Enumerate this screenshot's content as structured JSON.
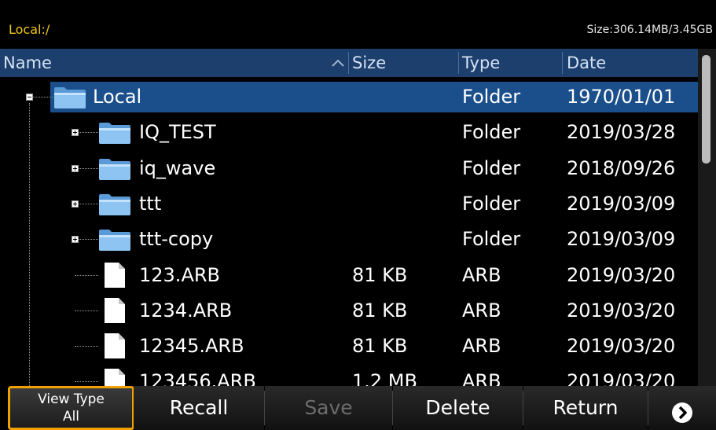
{
  "pathbar": {
    "path": "Local:/",
    "size": "Size:306.14MB/3.45GB"
  },
  "columns": {
    "name": "Name",
    "size": "Size",
    "type": "Type",
    "date": "Date"
  },
  "rows": [
    {
      "name": "Local",
      "size": "",
      "type": "Folder",
      "date": "1970/01/01",
      "kind": "folder",
      "level": 0,
      "expander": "minus",
      "selected": true
    },
    {
      "name": "IQ_TEST",
      "size": "",
      "type": "Folder",
      "date": "2019/03/28",
      "kind": "folder",
      "level": 1,
      "expander": "plus"
    },
    {
      "name": "iq_wave",
      "size": "",
      "type": "Folder",
      "date": "2018/09/26",
      "kind": "folder",
      "level": 1,
      "expander": "plus"
    },
    {
      "name": "ttt",
      "size": "",
      "type": "Folder",
      "date": "2019/03/09",
      "kind": "folder",
      "level": 1,
      "expander": "plus"
    },
    {
      "name": "ttt-copy",
      "size": "",
      "type": "Folder",
      "date": "2019/03/09",
      "kind": "folder",
      "level": 1,
      "expander": "plus"
    },
    {
      "name": "123.ARB",
      "size": "81 KB",
      "type": "ARB",
      "date": "2019/03/20",
      "kind": "file",
      "level": 1
    },
    {
      "name": "1234.ARB",
      "size": "81 KB",
      "type": "ARB",
      "date": "2019/03/20",
      "kind": "file",
      "level": 1
    },
    {
      "name": "12345.ARB",
      "size": "81 KB",
      "type": "ARB",
      "date": "2019/03/20",
      "kind": "file",
      "level": 1
    },
    {
      "name": "123456.ARB",
      "size": "1.2 MB",
      "type": "ARB",
      "date": "2019/03/20",
      "kind": "file",
      "level": 1
    }
  ],
  "softkeys": {
    "view_type": {
      "line1": "View Type",
      "line2": "All"
    },
    "recall": "Recall",
    "save": "Save",
    "delete": "Delete",
    "return": "Return"
  },
  "colors": {
    "path": "#f2c811",
    "header": "#1c3f6e",
    "selection": "#1b4f8c",
    "focus": "#f0a000"
  }
}
